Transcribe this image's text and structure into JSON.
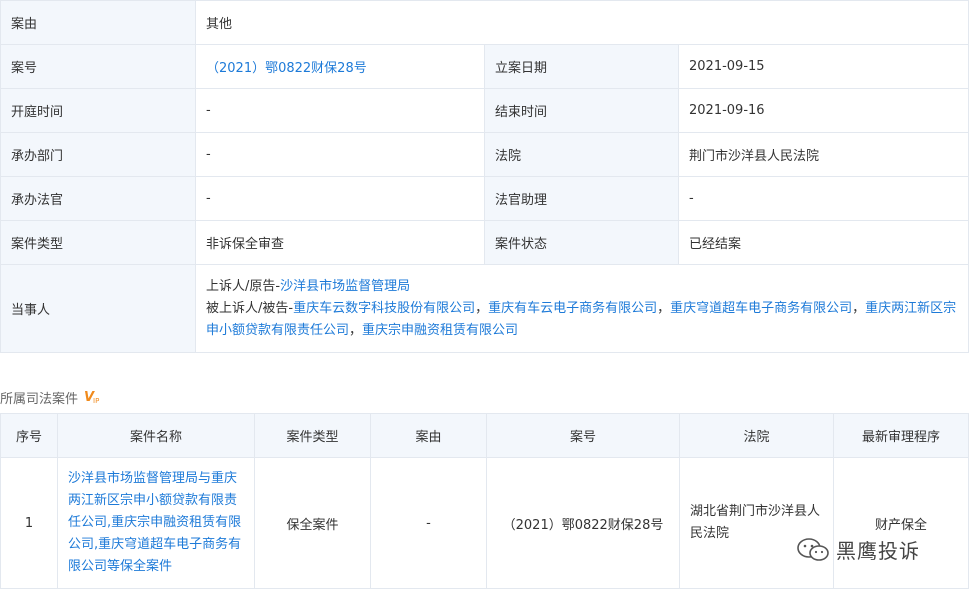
{
  "info": {
    "rows": [
      {
        "label": "案由",
        "value": "其他"
      },
      {
        "label": "案号",
        "value": "（2021）鄂0822财保28号",
        "label2": "立案日期",
        "value2": "2021-09-15"
      },
      {
        "label": "开庭时间",
        "value": "-",
        "label2": "结束时间",
        "value2": "2021-09-16"
      },
      {
        "label": "承办部门",
        "value": "-",
        "label2": "法院",
        "value2": "荆门市沙洋县人民法院"
      },
      {
        "label": "承办法官",
        "value": "-",
        "label2": "法官助理",
        "value2": "-"
      },
      {
        "label": "案件类型",
        "value": "非诉保全审查",
        "label2": "案件状态",
        "value2": "已经结案"
      }
    ],
    "party": {
      "label": "当事人",
      "plaintiff_role": "上诉人/原告-",
      "plaintiff": "沙洋县市场监督管理局",
      "defendant_role": "被上诉人/被告-",
      "defendants": [
        "重庆车云数字科技股份有限公司",
        "重庆有车云电子商务有限公司",
        "重庆穹道超车电子商务有限公司",
        "重庆两江新区宗申小额贷款有限责任公司",
        "重庆宗申融资租赁有限公司"
      ],
      "separator": "，"
    }
  },
  "section": {
    "title": "所属司法案件",
    "badge_icon": "vip-icon",
    "badge_text": "VIP"
  },
  "cases": {
    "headers": [
      "序号",
      "案件名称",
      "案件类型",
      "案由",
      "案号",
      "法院",
      "最新审理程序"
    ],
    "rows": [
      {
        "index": "1",
        "name": "沙洋县市场监督管理局与重庆两江新区宗申小额贷款有限责任公司,重庆宗申融资租赁有限公司,重庆穹道超车电子商务有限公司等保全案件",
        "type": "保全案件",
        "cause": "-",
        "number": "（2021）鄂0822财保28号",
        "court": "湖北省荆门市沙洋县人民法院",
        "procedure": "财产保全"
      }
    ]
  },
  "watermark": {
    "icon": "wechat-icon",
    "text": "黑鹰投诉"
  }
}
